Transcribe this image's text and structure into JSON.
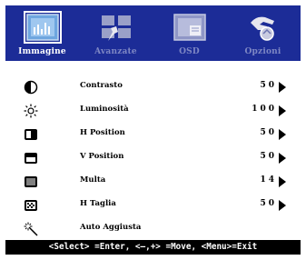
{
  "tabs": [
    {
      "label": "Immagine",
      "icon": "picture-icon",
      "active": true
    },
    {
      "label": "Avanzate",
      "icon": "advanced-settings-icon",
      "active": false
    },
    {
      "label": "OSD",
      "icon": "osd-icon",
      "active": false
    },
    {
      "label": "Opzioni",
      "icon": "options-hand-icon",
      "active": false
    }
  ],
  "menu_items": [
    {
      "icon": "contrast-icon",
      "label": "Contrasto",
      "value": "50"
    },
    {
      "icon": "brightness-icon",
      "label": "Luminosità",
      "value": "100"
    },
    {
      "icon": "h-position-icon",
      "label": "H Position",
      "value": "50"
    },
    {
      "icon": "v-position-icon",
      "label": "V Position",
      "value": "50"
    },
    {
      "icon": "phase-icon",
      "label": "Multa",
      "value": "14"
    },
    {
      "icon": "clock-icon",
      "label": "H Taglia",
      "value": "50"
    },
    {
      "icon": "auto-adjust-icon",
      "label": "Auto Aggiusta",
      "value": ""
    }
  ],
  "status_bar": "<Select> =Enter, <–,+> =Move, <Menu>=Exit",
  "colors": {
    "tab_bar": "#1c2c97",
    "inactive_label": "#7e87c4",
    "active_label": "#ffffff",
    "panel": "#ffffff",
    "status_bg": "#000000"
  }
}
